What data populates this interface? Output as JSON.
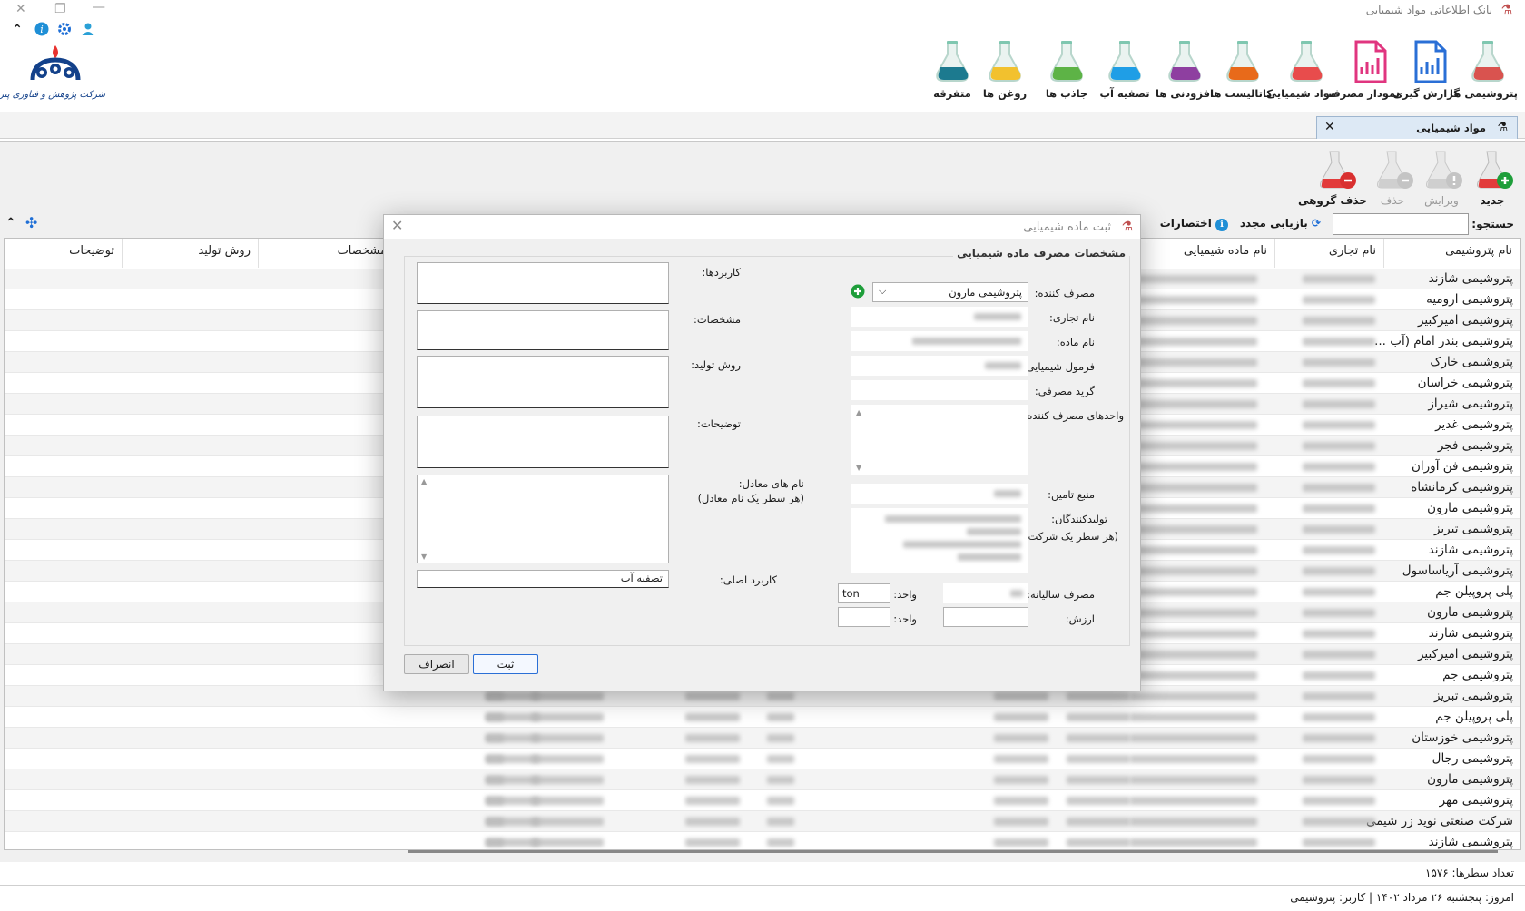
{
  "window": {
    "title": "بانک اطلاعاتی مواد شیمیایی"
  },
  "company_logo_text": "شرکت پژوهش و فناوری پتروشیمی",
  "ribbon": [
    {
      "label": "پتروشیمی ها",
      "icon": "petrochemical-icon",
      "color": "#d9534f"
    },
    {
      "label": "گزارش گیری",
      "icon": "report-icon",
      "color": "#2a6fd6"
    },
    {
      "label": "نمودار مصرف",
      "icon": "chart-icon",
      "color": "#e0357f"
    },
    {
      "label": "مواد شیمیایی",
      "icon": "chemicals-icon",
      "color": "#e84c4c"
    },
    {
      "label": "کاتالیست ها",
      "icon": "catalyst-icon",
      "color": "#e86a1a"
    },
    {
      "label": "افزودنی ها",
      "icon": "additive-icon",
      "color": "#8e3fa0"
    },
    {
      "label": "تصفیه آب",
      "icon": "water-treatment-icon",
      "color": "#1f9ee6"
    },
    {
      "label": "جاذب ها",
      "icon": "adsorbent-icon",
      "color": "#5db346"
    },
    {
      "label": "روغن ها",
      "icon": "oil-icon",
      "color": "#f2c12e"
    },
    {
      "label": "متفرقه",
      "icon": "misc-icon",
      "color": "#1c7a8f"
    }
  ],
  "doc_tab": {
    "label": "مواد شیمیایی"
  },
  "actions": {
    "new": "جدید",
    "edit": "ویرایش",
    "delete": "حذف",
    "group_delete": "حذف گروهی"
  },
  "search": {
    "label": "جستجو:",
    "value": ""
  },
  "toolbar": {
    "refresh": "بازیابی مجدد",
    "shortcuts": "اختصارات"
  },
  "grid": {
    "columns": [
      "نام پتروشیمی",
      "نام تجاری",
      "نام ماده شیمیایی",
      "مشخصات",
      "روش تولید",
      "توضیحات"
    ],
    "rows": [
      "پتروشیمی شازند",
      "پتروشیمی ارومیه",
      "پتروشیمی امیرکبیر",
      "پتروشیمی بندر امام (آب ...",
      "پتروشیمی خارک",
      "پتروشیمی خراسان",
      "پتروشیمی شیراز",
      "پتروشیمی غدیر",
      "پتروشیمی فجر",
      "پتروشیمی فن آوران",
      "پتروشیمی کرمانشاه",
      "پتروشیمی مارون",
      "پتروشیمی تبریز",
      "پتروشیمی شازند",
      "پتروشیمی آریاساسول",
      "پلی پروپیلن جم",
      "پتروشیمی مارون",
      "پتروشیمی شازند",
      "پتروشیمی امیرکبیر",
      "پتروشیمی جم",
      "پتروشیمی تبریز",
      "پلی پروپیلن جم",
      "پتروشیمی خوزستان",
      "پتروشیمی رجال",
      "پتروشیمی مارون",
      "پتروشیمی مهر",
      "شرکت صنعتی نوید زر شیمی",
      "پتروشیمی شازند"
    ]
  },
  "status": {
    "row_count": "تعداد سطرها:  ۱۵۷۶",
    "today": "امروز: پنجشنبه ۲۶ مرداد ۱۴۰۲   |   کاربر: پتروشیمی"
  },
  "dialog": {
    "title": "ثبت ماده شیمیایی",
    "group_title": "مشخصات مصرف ماده شیمیایی",
    "consumer_label": "مصرف کننده:",
    "consumer_value": "پتروشیمی مارون",
    "trade_name_label": "نام تجاری:",
    "material_name_label": "نام ماده:",
    "formula_label": "فرمول شیمیایی:",
    "grade_label": "گرید مصرفی:",
    "units_label": "واحدهای مصرف کننده:",
    "supply_label": "منبع تامین:",
    "producers_label": "تولیدکنندگان:",
    "producers_hint": "(هر سطر یک شرکت)",
    "annual_label": "مصرف سالیانه:",
    "unit_label": "واحد:",
    "annual_unit_value": "ton",
    "value_label": "ارزش:",
    "value_unit_label": "واحد:",
    "uses_label": "کاربردها:",
    "specs_label": "مشخصات:",
    "method_label": "روش تولید:",
    "desc_label": "توضیحات:",
    "equiv_label": "نام های معادل:",
    "equiv_hint": "(هر سطر یک نام معادل)",
    "main_use_label": "کاربرد اصلی:",
    "main_use_value": "تصفیه آب",
    "submit": "ثبت",
    "cancel": "انصراف"
  }
}
